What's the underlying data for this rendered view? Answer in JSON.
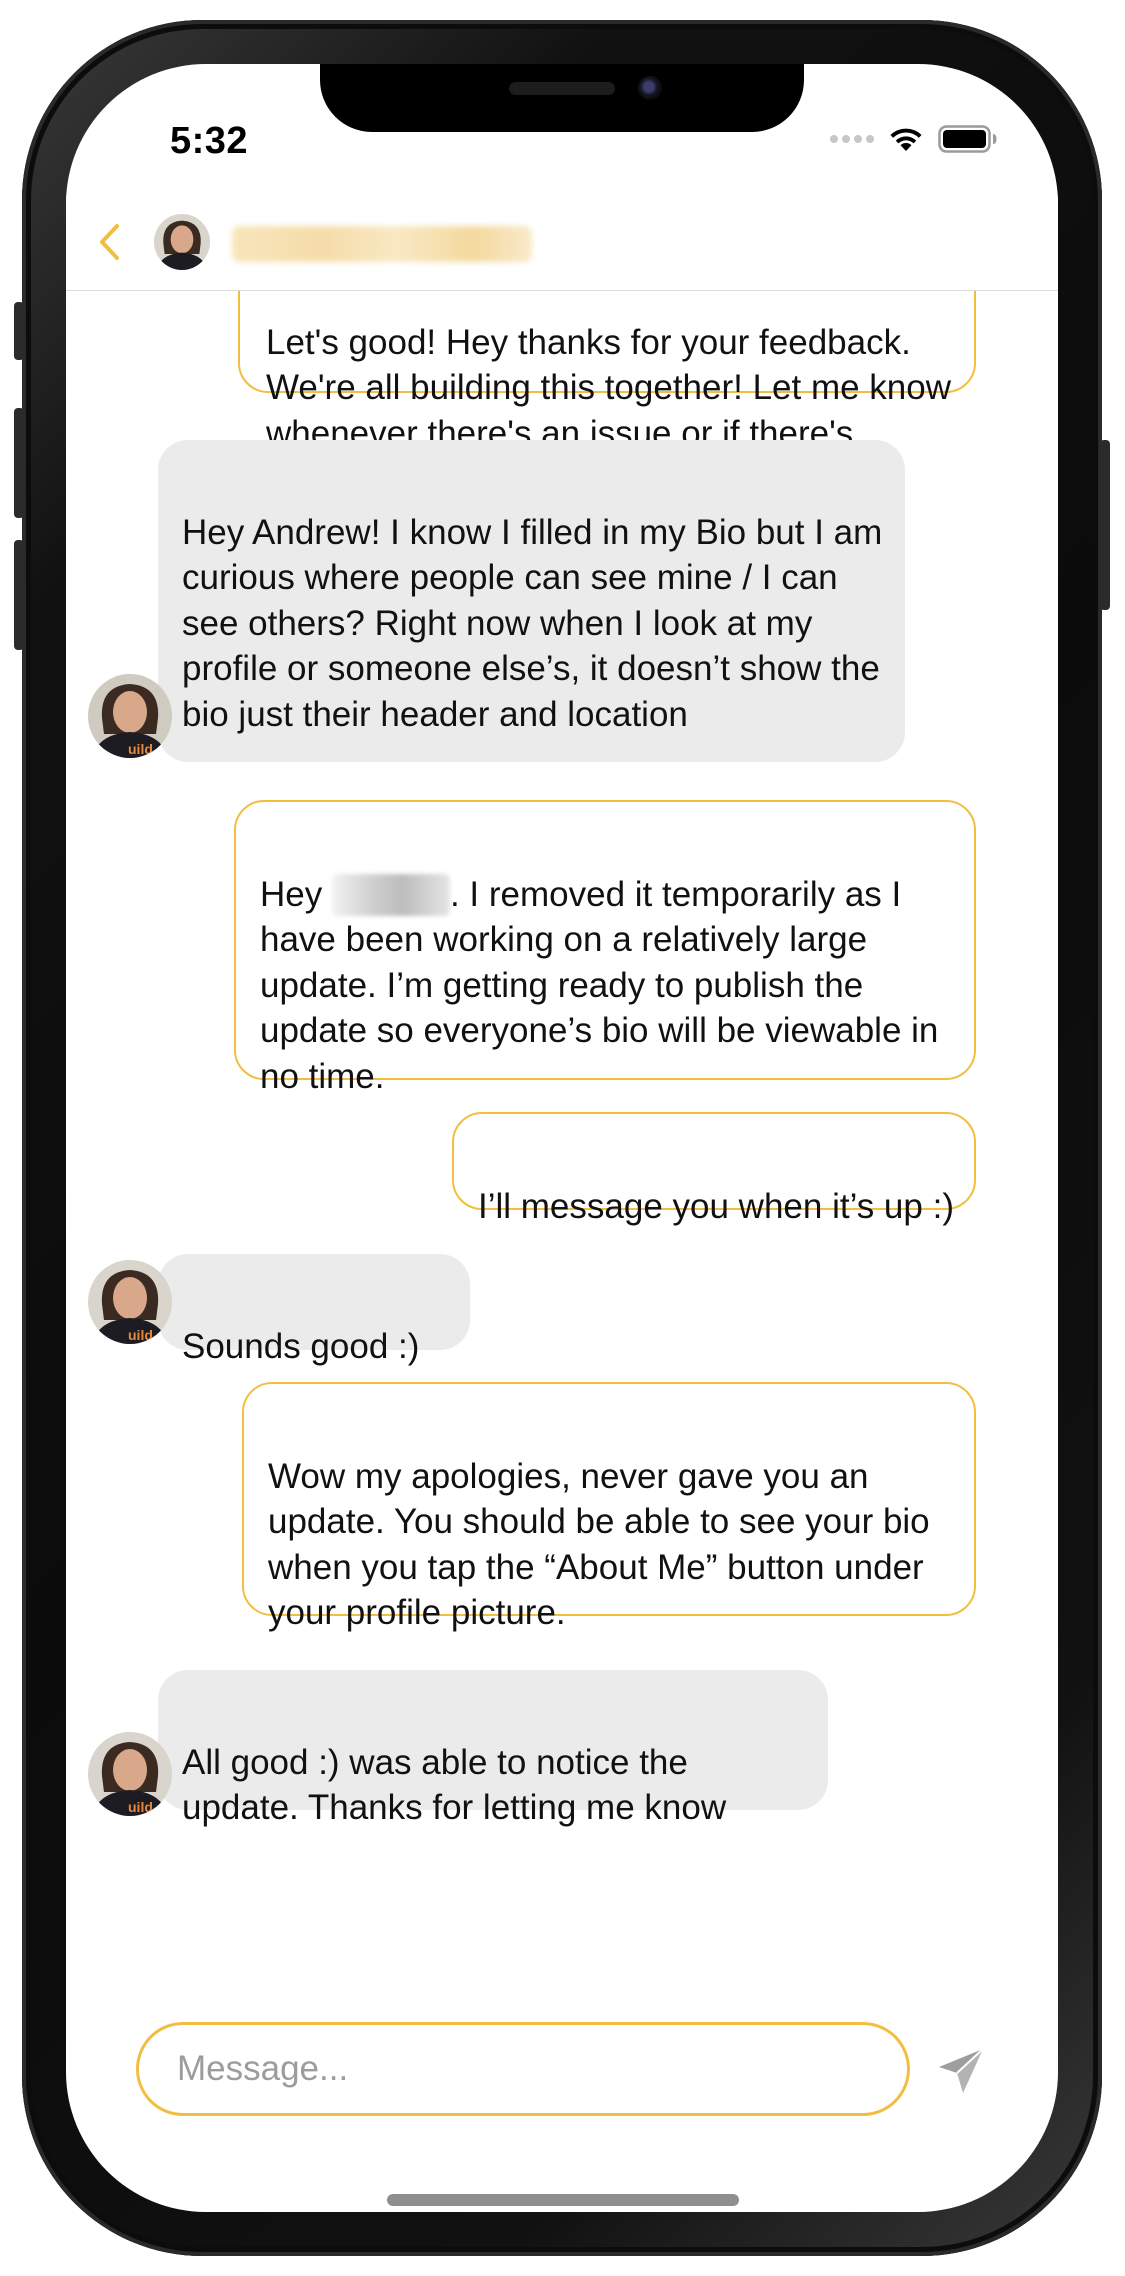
{
  "status_bar": {
    "time": "5:32"
  },
  "header": {
    "contact_name": "",
    "accent_color": "#f2be3f"
  },
  "messages": [
    {
      "direction": "out",
      "text": "Let's good! Hey thanks for your feedback. We're all building this together! Let me know whenever there's an issue or if there's something I could add/improve. Much appreciated!"
    },
    {
      "direction": "in",
      "text": "Hey Andrew! I know I filled in my Bio but I am curious where people can see mine / I can see others? Right now when I look at my profile or someone else’s, it doesn’t show the bio just their header and location"
    },
    {
      "direction": "out",
      "text_before": "Hey ",
      "text_after": ". I removed it temporarily as I have been working on a relatively large update. I’m getting ready to publish the update so everyone’s bio will be viewable in no time."
    },
    {
      "direction": "out",
      "text": "I’ll message you when it’s up :)"
    },
    {
      "direction": "in",
      "text": "Sounds good :)"
    },
    {
      "direction": "out",
      "text": "Wow my apologies, never gave you an update. You should be able to see your bio when you tap the “About Me” button under your profile picture."
    },
    {
      "direction": "in",
      "text": "All good :) was able to notice the update. Thanks for letting me know"
    }
  ],
  "composer": {
    "placeholder": "Message...",
    "value": ""
  },
  "colors": {
    "outgoing_border": "#f2be3f",
    "incoming_bg": "#ebebeb",
    "send_icon": "#9e9e9e"
  }
}
